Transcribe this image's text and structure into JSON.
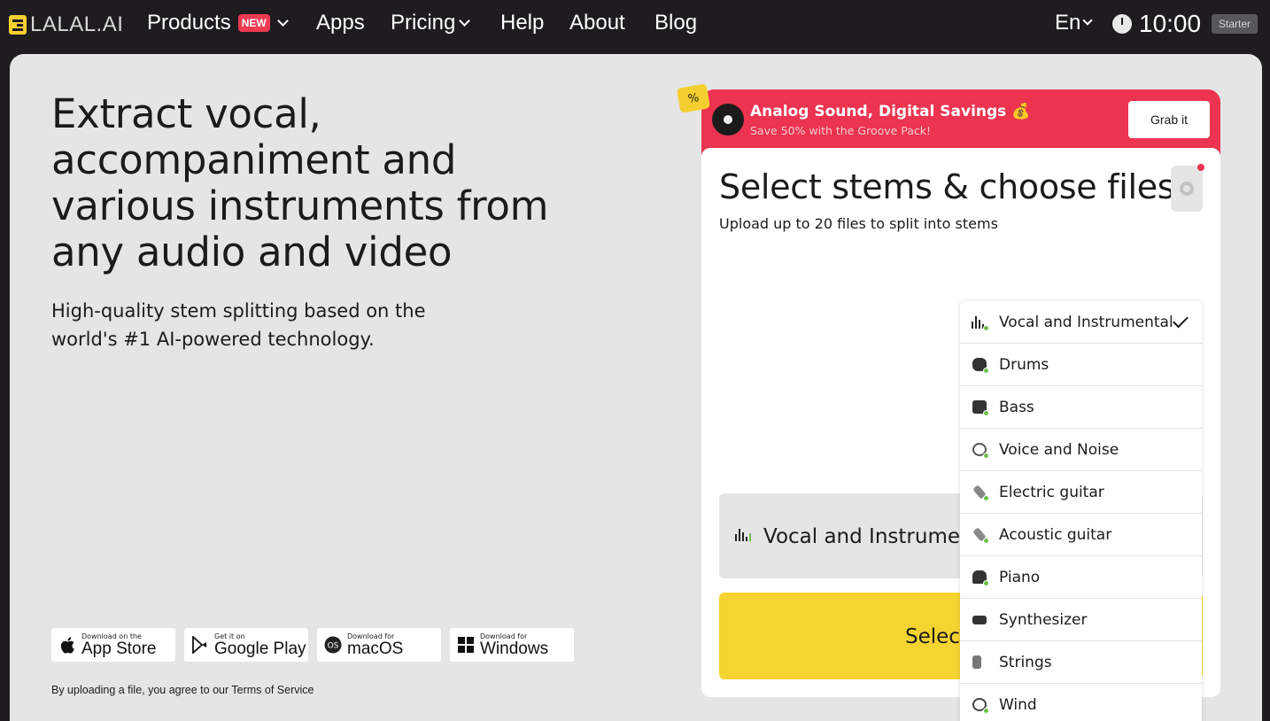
{
  "nav": {
    "logo": "LALAL.AI",
    "items": [
      {
        "label": "Products",
        "badge": "NEW",
        "has_dropdown": true
      },
      {
        "label": "Apps"
      },
      {
        "label": "Pricing",
        "has_dropdown": true
      },
      {
        "label": "Help"
      },
      {
        "label": "About"
      },
      {
        "label": "Blog"
      }
    ],
    "language": "En",
    "time": "10:00",
    "plan": "Starter"
  },
  "hero": {
    "title": "Extract vocal, accompaniment and various instruments from any audio and video",
    "subtitle": "High-quality stem splitting based on the world's #1 AI-powered technology."
  },
  "stores": [
    {
      "small": "Download on the",
      "big": "App Store",
      "icon": "apple-icon"
    },
    {
      "small": "Get it on",
      "big": "Google Play",
      "icon": "google-play-icon"
    },
    {
      "small": "Download for",
      "big": "macOS",
      "icon": "macos-icon"
    },
    {
      "small": "Download for",
      "big": "Windows",
      "icon": "windows-icon"
    }
  ],
  "terms": "By uploading a file, you agree to our Terms of Service",
  "promo": {
    "tag": "%",
    "title": "Analog Sound, Digital Savings 💰",
    "subtitle": "Save 50% with the Groove Pack!",
    "button": "Grab it",
    "accent": "#ec3350"
  },
  "card": {
    "title": "Select stems & choose files",
    "subtitle": "Upload up to 20 files to split into stems",
    "selected_stem": "Vocal and Instrumental",
    "select_button": "Select"
  },
  "stems": [
    {
      "label": "Vocal and Instrumental",
      "icon": "waveform-icon",
      "selected": true
    },
    {
      "label": "Drums",
      "icon": "drum-icon"
    },
    {
      "label": "Bass",
      "icon": "bass-amp-icon"
    },
    {
      "label": "Voice and Noise",
      "icon": "microphone-icon"
    },
    {
      "label": "Electric guitar",
      "icon": "electric-guitar-icon"
    },
    {
      "label": "Acoustic guitar",
      "icon": "acoustic-guitar-icon"
    },
    {
      "label": "Piano",
      "icon": "piano-icon"
    },
    {
      "label": "Synthesizer",
      "icon": "synthesizer-icon"
    },
    {
      "label": "Strings",
      "icon": "harp-icon"
    },
    {
      "label": "Wind",
      "icon": "horn-icon"
    }
  ],
  "colors": {
    "brand_yellow": "#f5d431",
    "promo_red": "#ec3350",
    "status_green": "#6cc04a"
  }
}
